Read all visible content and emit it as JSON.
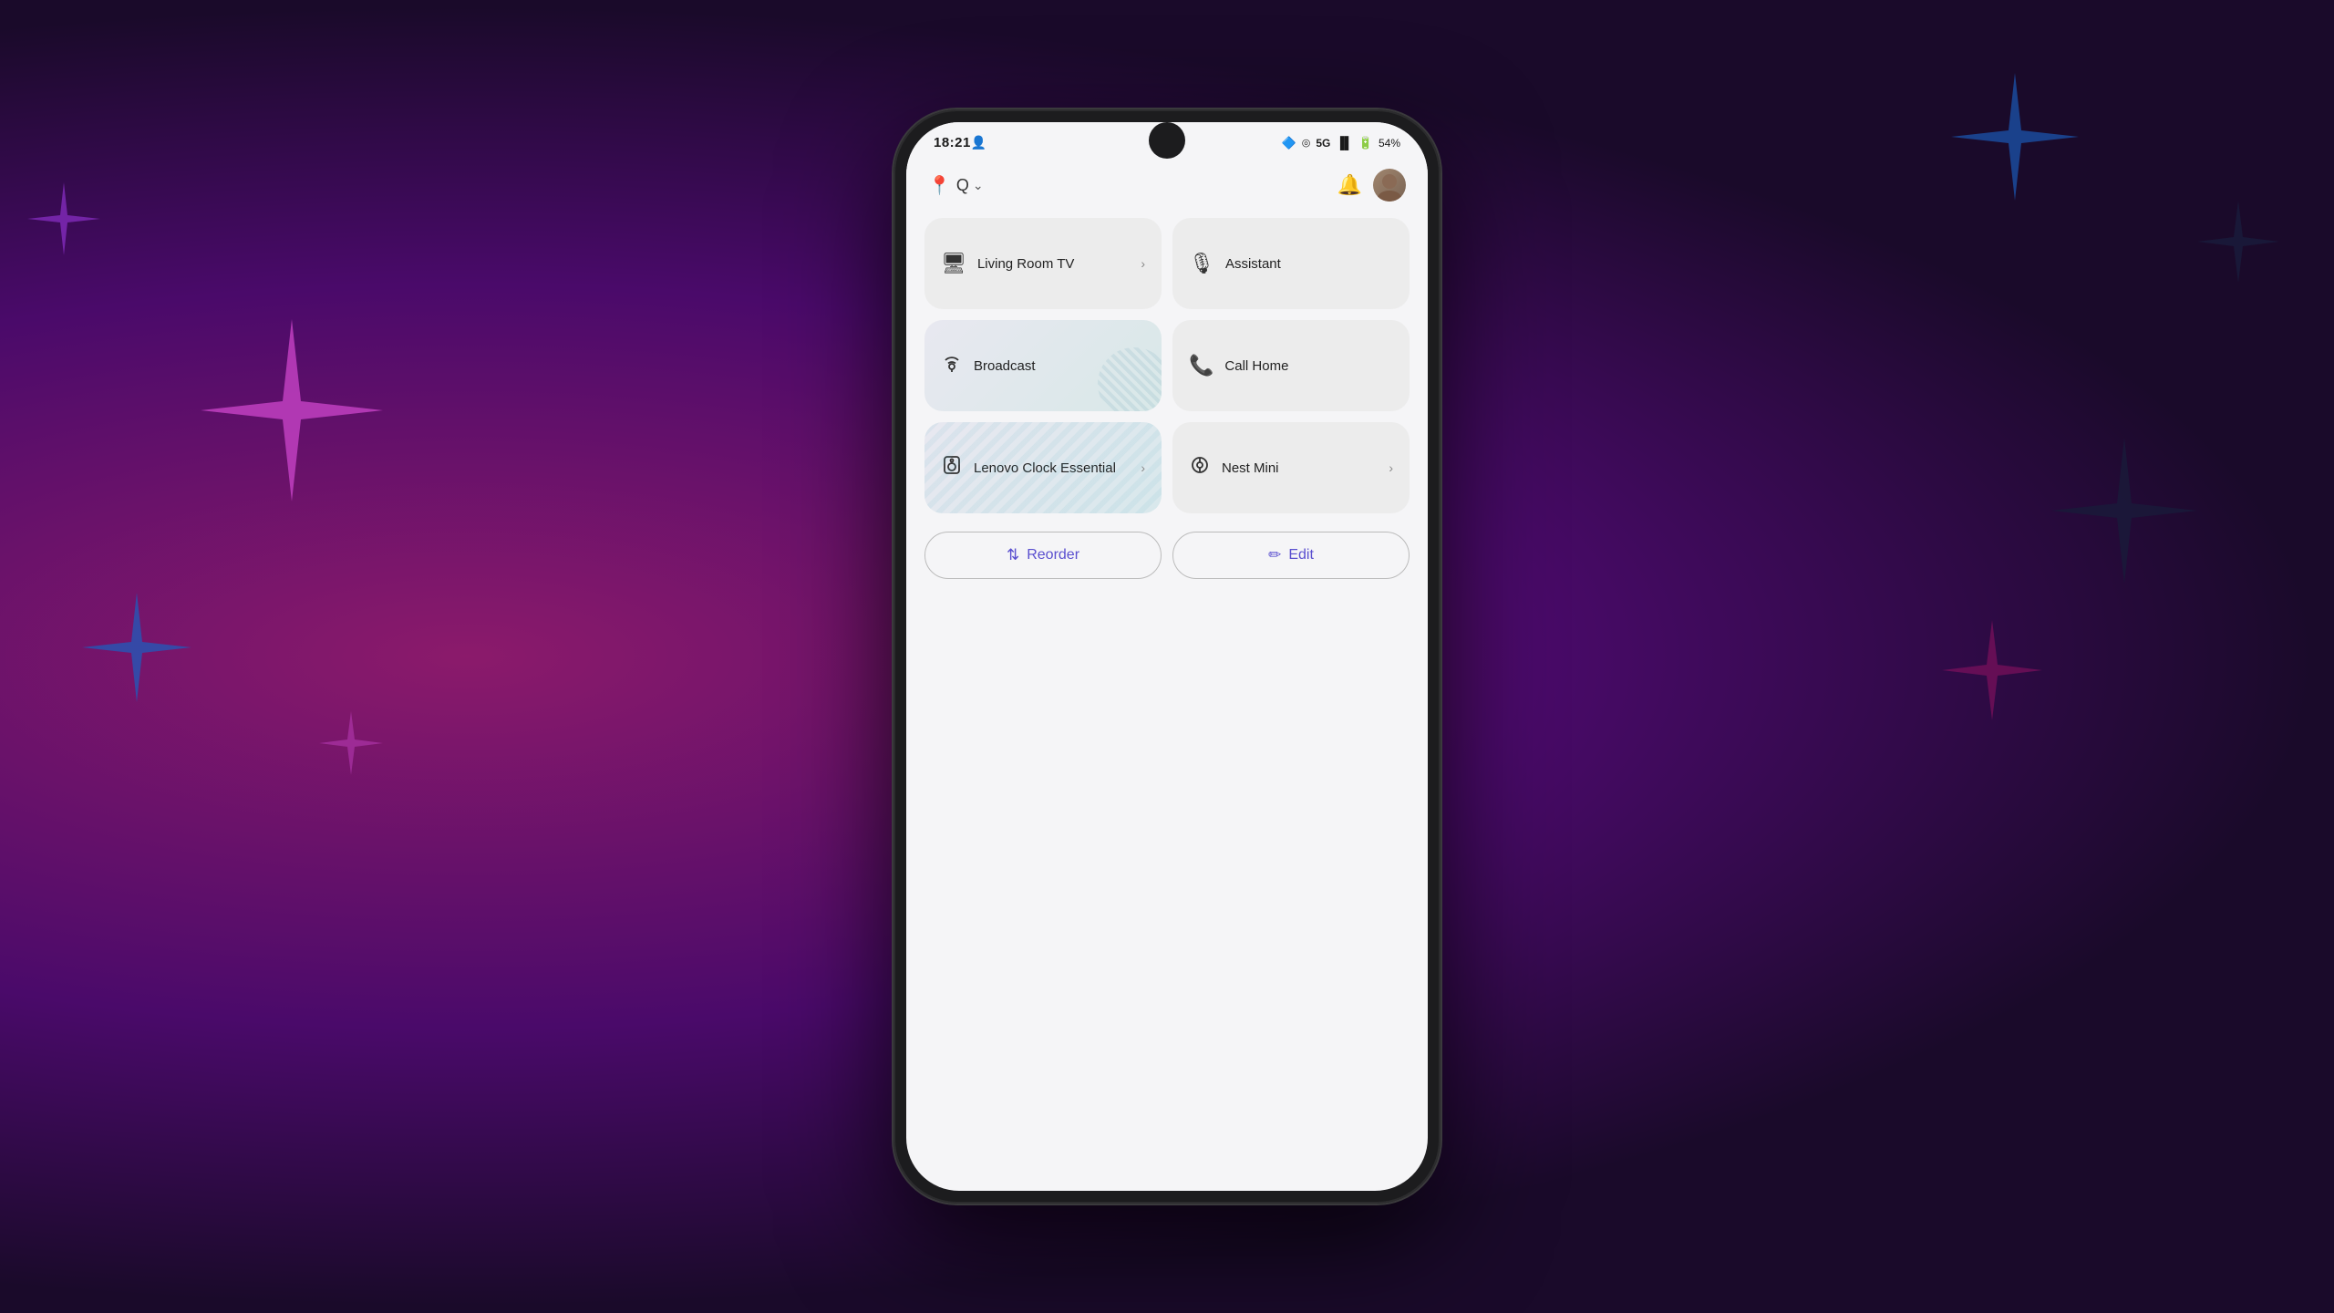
{
  "background": {
    "description": "Purple gradient background with sparkle star shapes"
  },
  "phone": {
    "status_bar": {
      "time": "18:21",
      "battery": "54%",
      "signal": "5G",
      "bluetooth_icon": "bluetooth",
      "wifi_icon": "wifi"
    },
    "header": {
      "location_icon": "location-pin",
      "home_label": "Q",
      "chevron_icon": "chevron-down",
      "bell_icon": "bell",
      "avatar_alt": "user-avatar"
    },
    "grid": {
      "rows": [
        {
          "cards": [
            {
              "id": "living-room-tv",
              "icon": "tv",
              "label": "Living Room TV",
              "has_chevron": true
            },
            {
              "id": "assistant",
              "icon": "mic",
              "label": "Assistant",
              "has_chevron": false
            }
          ]
        },
        {
          "cards": [
            {
              "id": "broadcast",
              "icon": "broadcast",
              "label": "Broadcast",
              "has_chevron": false
            },
            {
              "id": "call-home",
              "icon": "phone",
              "label": "Call Home",
              "has_chevron": false
            }
          ]
        },
        {
          "cards": [
            {
              "id": "lenovo-clock",
              "icon": "speaker",
              "label": "Lenovo Clock Essential",
              "has_chevron": true
            },
            {
              "id": "nest-mini",
              "icon": "smart-speaker",
              "label": "Nest Mini",
              "has_chevron": true
            }
          ]
        }
      ]
    },
    "bottom_buttons": [
      {
        "id": "reorder",
        "icon": "↕",
        "label": "Reorder"
      },
      {
        "id": "edit",
        "icon": "✏",
        "label": "Edit"
      }
    ]
  }
}
